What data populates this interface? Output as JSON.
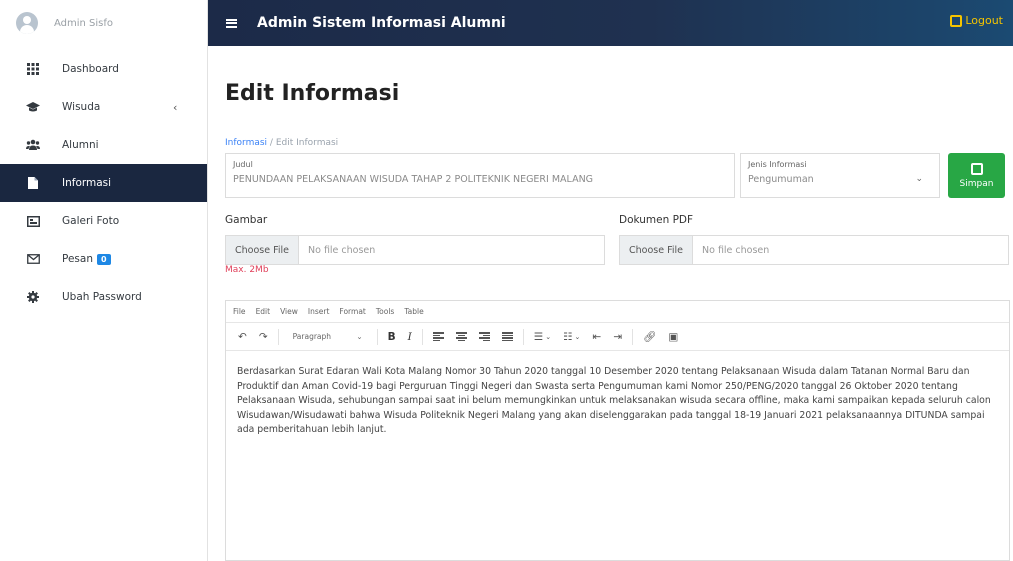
{
  "sidebar": {
    "user_name": "Admin Sisfo",
    "items": [
      {
        "label": "Dashboard",
        "icon": "grid-icon"
      },
      {
        "label": "Wisuda",
        "icon": "graduation-cap-icon",
        "chevron": "‹"
      },
      {
        "label": "Alumni",
        "icon": "users-icon"
      },
      {
        "label": "Informasi",
        "icon": "file-icon",
        "active": true
      },
      {
        "label": "Galeri Foto",
        "icon": "image-icon"
      },
      {
        "label": "Pesan",
        "icon": "envelope-icon",
        "badge": "0"
      },
      {
        "label": "Ubah Password",
        "icon": "gear-icon"
      }
    ]
  },
  "header": {
    "app_title": "Admin Sistem Informasi Alumni",
    "logout_label": "Logout"
  },
  "page": {
    "title": "Edit Informasi",
    "breadcrumb_link": "Informasi",
    "breadcrumb_separator": "/",
    "breadcrumb_current": "Edit Informasi"
  },
  "form": {
    "judul_label": "Judul",
    "judul_value": "PENUNDAAN PELAKSANAAN WISUDA TAHAP 2 POLITEKNIK NEGERI MALANG",
    "jenis_label": "Jenis Informasi",
    "jenis_value": "Pengumuman",
    "save_label": "Simpan",
    "gambar_label": "Gambar",
    "dokumen_label": "Dokumen PDF",
    "choose_file_label": "Choose File",
    "no_file_text": "No file chosen",
    "max_note": "Max. 2Mb"
  },
  "editor": {
    "menus": [
      "File",
      "Edit",
      "View",
      "Insert",
      "Format",
      "Tools",
      "Table"
    ],
    "format_select": "Paragraph",
    "content": "Berdasarkan Surat Edaran Wali Kota Malang Nomor 30 Tahun 2020 tanggal 10 Desember 2020 tentang Pelaksanaan Wisuda dalam Tatanan Normal Baru dan Produktif dan Aman Covid-19 bagi Perguruan Tinggi Negeri dan Swasta serta Pengumuman kami Nomor 250/PENG/2020 tanggal 26 Oktober 2020 tentang Pelaksanaan Wisuda, sehubungan sampai saat ini belum memungkinkan untuk melaksanakan wisuda secara offline, maka kami sampaikan kepada seluruh calon Wisudawan/Wisudawati bahwa Wisuda Politeknik Negeri Malang yang akan diselenggarakan pada tanggal 18-19 Januari 2021 pelaksanaannya DITUNDA sampai ada pemberitahuan lebih lanjut."
  },
  "colors": {
    "sidebar_active": "#1a2740",
    "topbar": "#1c2a48",
    "save_button": "#28a745",
    "logout": "#f5c400",
    "max_note": "#e0405a"
  }
}
